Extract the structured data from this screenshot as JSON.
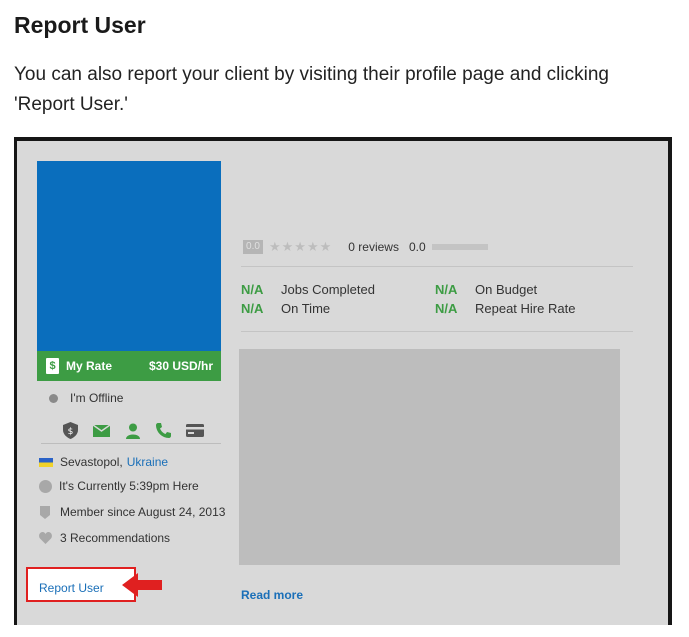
{
  "heading": "Report User",
  "description": "You can also report your client by visiting their profile page and clicking 'Report User.'",
  "profile": {
    "rate_label": "My Rate",
    "rate_value": "$30 USD/hr",
    "status": "I'm Offline",
    "location_city": "Sevastopol,",
    "location_country": "Ukraine",
    "local_time": "It's Currently 5:39pm Here",
    "member_since": "Member since August 24, 2013",
    "recommendations": "3 Recommendations",
    "report_link": "Report User",
    "score": "0.0",
    "reviews": "0 reviews",
    "earnings_score": "0.0",
    "read_more": "Read more",
    "icons": [
      "shield-dollar-icon",
      "envelope-icon",
      "user-icon",
      "phone-icon",
      "credit-card-icon"
    ],
    "stats": [
      {
        "value": "N/A",
        "label": "Jobs Completed"
      },
      {
        "value": "N/A",
        "label": "On Time"
      },
      {
        "value": "N/A",
        "label": "On Budget"
      },
      {
        "value": "N/A",
        "label": "Repeat Hire Rate"
      }
    ]
  },
  "colors": {
    "profile_blue": "#0a6ebd",
    "rate_green": "#3d9c44",
    "highlight_red": "#e02020",
    "link_blue": "#1a6fb8"
  }
}
